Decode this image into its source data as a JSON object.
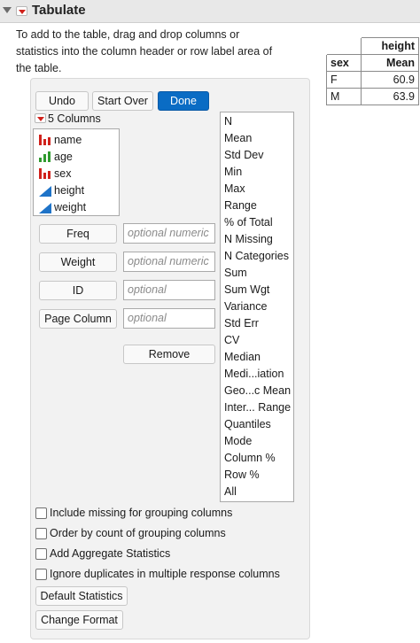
{
  "header": {
    "title": "Tabulate"
  },
  "instructions": "To add to the table, drag and drop columns or statistics into the column header or row label area of the table.",
  "result_table": {
    "column_header": "height",
    "row_label_header": "sex",
    "stat_header": "Mean",
    "rows": [
      {
        "label": "F",
        "value": "60.9"
      },
      {
        "label": "M",
        "value": "63.9"
      }
    ]
  },
  "toolbar": {
    "undo": "Undo",
    "start_over": "Start Over",
    "done": "Done"
  },
  "columns": {
    "count_label": "5 Columns",
    "items": [
      {
        "name": "name",
        "type": "nominal"
      },
      {
        "name": "age",
        "type": "ordinal"
      },
      {
        "name": "sex",
        "type": "nominal"
      },
      {
        "name": "height",
        "type": "continuous"
      },
      {
        "name": "weight",
        "type": "continuous"
      }
    ]
  },
  "roles": {
    "freq": {
      "label": "Freq",
      "placeholder": "optional numeric"
    },
    "weight": {
      "label": "Weight",
      "placeholder": "optional numeric"
    },
    "id": {
      "label": "ID",
      "placeholder": "optional"
    },
    "page_column": {
      "label": "Page Column",
      "placeholder": "optional"
    },
    "remove": "Remove"
  },
  "statistics": [
    "N",
    "Mean",
    "Std Dev",
    "Min",
    "Max",
    "Range",
    "% of Total",
    "N Missing",
    "N Categories",
    "Sum",
    "Sum Wgt",
    "Variance",
    "Std Err",
    "CV",
    "Median",
    "Medi...iation",
    "Geo...c Mean",
    "Inter... Range",
    "Quantiles",
    "Mode",
    "Column %",
    "Row %",
    "All"
  ],
  "options": {
    "include_missing": "Include missing for grouping columns",
    "order_by_count": "Order by count of grouping columns",
    "add_aggregate": "Add Aggregate Statistics",
    "ignore_duplicates": "Ignore duplicates in multiple response columns"
  },
  "bottom_buttons": {
    "default_statistics": "Default Statistics",
    "change_format": "Change Format"
  },
  "colors": {
    "accent": "#0a6cc4",
    "nominal": "#d0211b",
    "ordinal": "#2e9a2e",
    "continuous": "#1e73c8"
  }
}
